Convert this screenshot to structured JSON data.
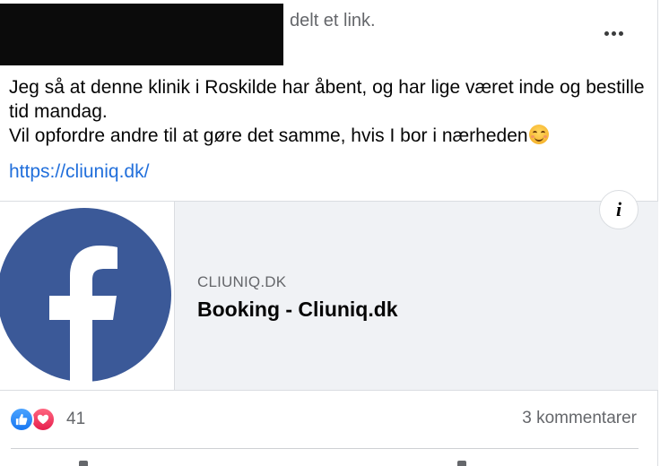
{
  "post": {
    "author_redacted": true,
    "shared_text": "delt et link.",
    "more_icon": "more-horizontal-icon",
    "message_lines": [
      "Jeg så at denne klinik i Roskilde har åbent, og har lige været inde og bestille tid mandag.",
      "Vil opfordre andre til at gøre det samme, hvis I bor i nærheden"
    ],
    "message_emoji": "smiling-face-icon",
    "link_url": "https://cliuniq.dk/"
  },
  "link_card": {
    "thumbnail": "facebook-logo",
    "domain": "CLIUNIQ.DK",
    "title": "Booking - Cliuniq.dk",
    "info_icon": "info-icon",
    "colors": {
      "logo_blue": "#3b5998",
      "card_bg": "#f0f2f5"
    }
  },
  "engagement": {
    "reaction_icons": [
      "like-reaction-icon",
      "love-reaction-icon"
    ],
    "reaction_count": "41",
    "comments_label": "3 kommentarer"
  }
}
